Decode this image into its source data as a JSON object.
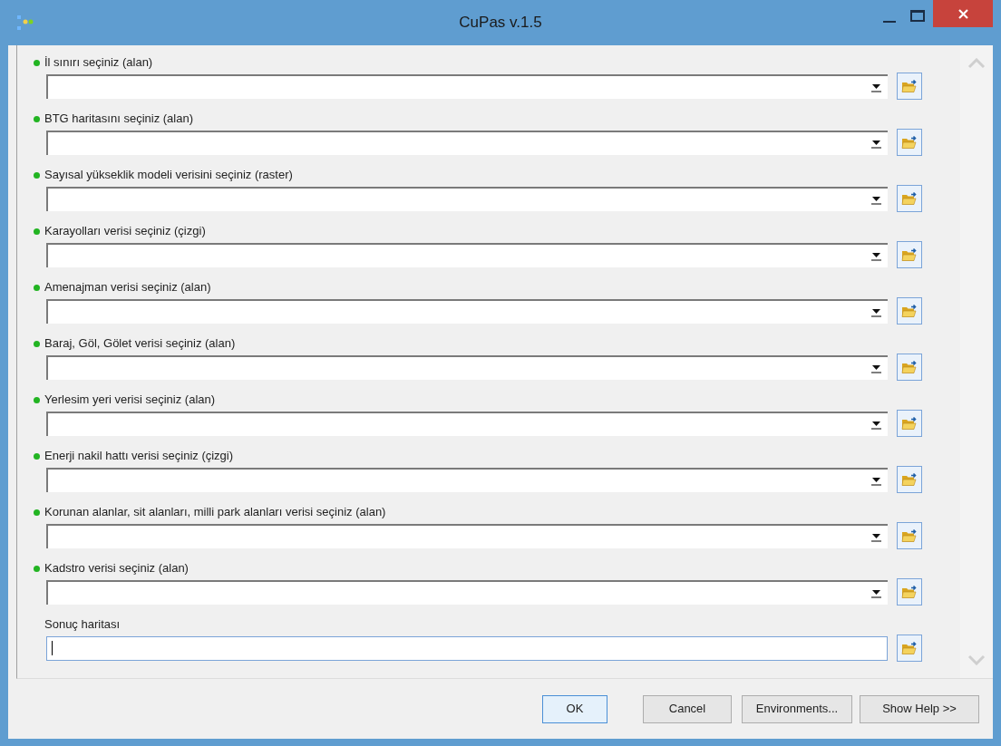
{
  "window": {
    "title": "CuPas v.1.5"
  },
  "parameters": [
    {
      "label": "İl sınırı seçiniz (alan)",
      "required": true,
      "kind": "dropdown"
    },
    {
      "label": "BTG haritasını seçiniz (alan)",
      "required": true,
      "kind": "dropdown"
    },
    {
      "label": "Sayısal yükseklik modeli verisini seçiniz (raster)",
      "required": true,
      "kind": "dropdown"
    },
    {
      "label": "Karayolları verisi seçiniz (çizgi)",
      "required": true,
      "kind": "dropdown"
    },
    {
      "label": "Amenajman verisi seçiniz (alan)",
      "required": true,
      "kind": "dropdown"
    },
    {
      "label": "Baraj, Göl, Gölet verisi seçiniz (alan)",
      "required": true,
      "kind": "dropdown"
    },
    {
      "label": "Yerlesim yeri verisi seçiniz (alan)",
      "required": true,
      "kind": "dropdown"
    },
    {
      "label": "Enerji nakil hattı verisi seçiniz (çizgi)",
      "required": true,
      "kind": "dropdown"
    },
    {
      "label": "Korunan alanlar, sit alanları, milli park alanları verisi seçiniz (alan)",
      "required": true,
      "kind": "dropdown"
    },
    {
      "label": "Kadstro verisi seçiniz (alan)",
      "required": true,
      "kind": "dropdown"
    },
    {
      "label": "Sonuç haritası",
      "required": false,
      "kind": "text",
      "focused": true
    }
  ],
  "buttons": [
    {
      "label": "OK",
      "default": true
    },
    {
      "label": "Cancel",
      "default": false
    },
    {
      "label": "Environments...",
      "default": false
    },
    {
      "label": "Show Help >>",
      "default": false
    }
  ]
}
